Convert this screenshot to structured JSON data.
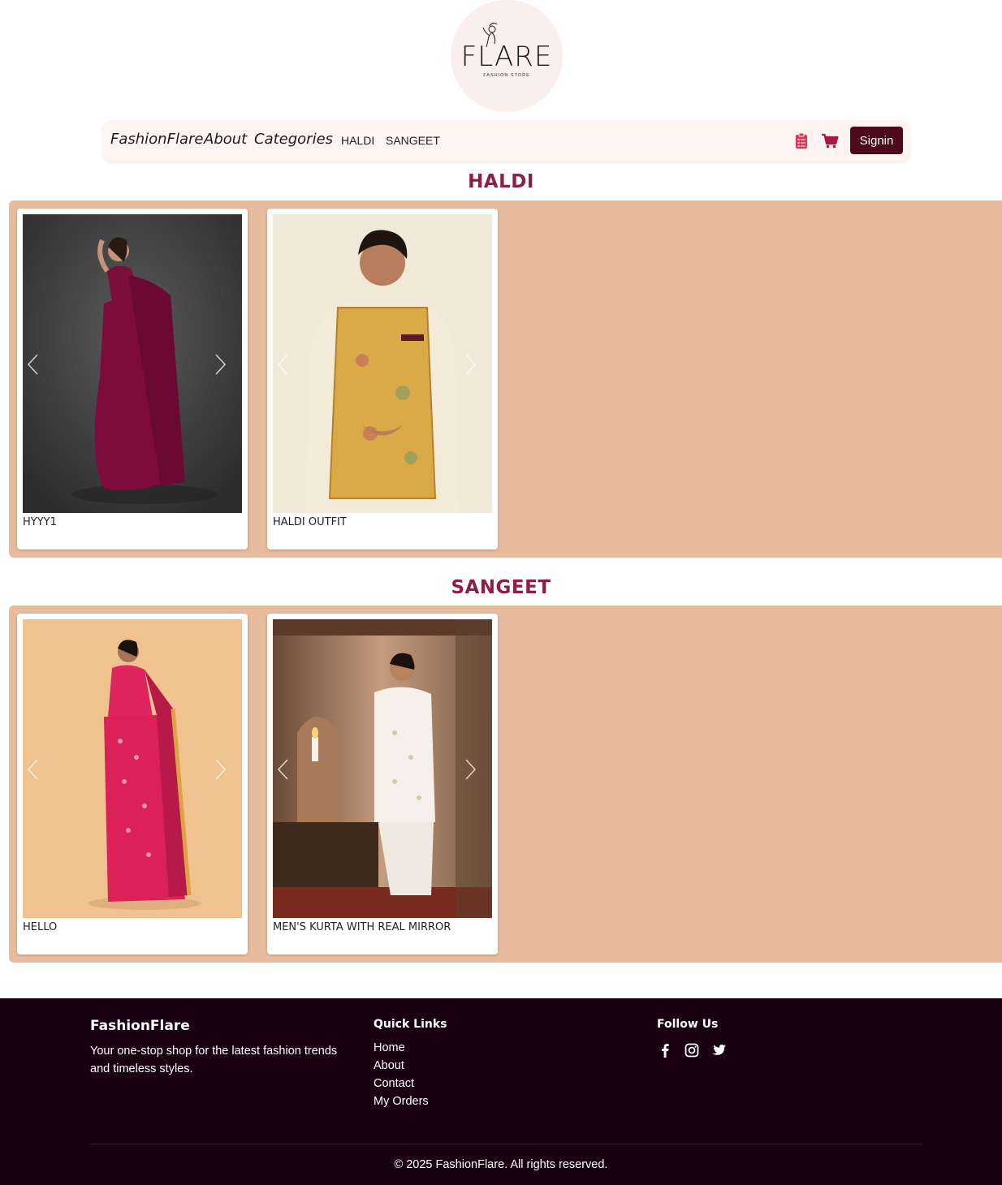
{
  "logo": {
    "text": "FLARE",
    "subtitle": "FASHION STORE",
    "bg_color": "#fbefee"
  },
  "navbar": {
    "brand": "FashionFlare",
    "links": [
      "About",
      "Categories"
    ],
    "categories": [
      "HALDI",
      "SANGEET"
    ],
    "icons": [
      "clipboard-list-icon",
      "shopping-cart-icon"
    ],
    "signin_label": "Signin",
    "accent_color": "#4c0a1c",
    "icon_color": "#b0153d"
  },
  "sections": [
    {
      "title": "HALDI",
      "products": [
        {
          "name": "HYYY1"
        },
        {
          "name": "HALDI OUTFIT"
        }
      ]
    },
    {
      "title": "SANGEET",
      "products": [
        {
          "name": "HELLO"
        },
        {
          "name": "MEN'S KURTA WITH REAL MIRROR"
        }
      ]
    }
  ],
  "colors": {
    "section_title": "#8a1f4a",
    "panel_bg": "#e7bb9d",
    "footer_bg": "#190010"
  },
  "footer": {
    "brand": "FashionFlare",
    "description": "Your one-stop shop for the latest fashion trends and timeless styles.",
    "quick_links_heading": "Quick Links",
    "quick_links": [
      "Home",
      "About",
      "Contact",
      "My Orders"
    ],
    "follow_heading": "Follow Us",
    "social_icons": [
      "facebook-icon",
      "instagram-icon",
      "twitter-icon"
    ],
    "copyright": "© 2025 FashionFlare. All rights reserved."
  }
}
